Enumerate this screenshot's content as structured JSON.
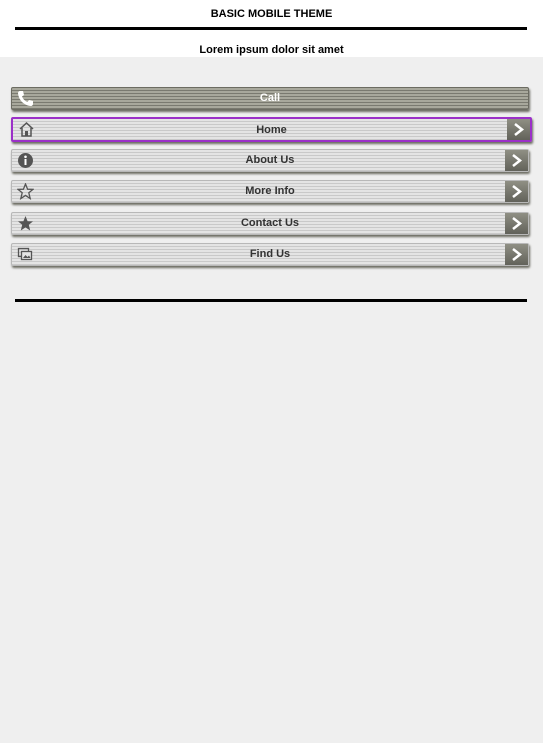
{
  "header": {
    "title": "BASIC MOBILE THEME",
    "subtitle": "Lorem ipsum dolor sit amet"
  },
  "menu": [
    {
      "label": "Call",
      "icon": "phone-icon",
      "arrow": false,
      "style": "dark"
    },
    {
      "label": "Home",
      "icon": "home-icon",
      "arrow": true,
      "active": true
    },
    {
      "label": "About Us",
      "icon": "info-icon",
      "arrow": true
    },
    {
      "label": "More Info",
      "icon": "star-outline-icon",
      "arrow": true
    },
    {
      "label": "Contact Us",
      "icon": "star-filled-icon",
      "arrow": true
    },
    {
      "label": "Find Us",
      "icon": "gallery-icon",
      "arrow": true
    }
  ],
  "colors": {
    "accent_active_border": "#9b30c8",
    "button_dark": "#7a7a70",
    "background": "#efefef"
  }
}
